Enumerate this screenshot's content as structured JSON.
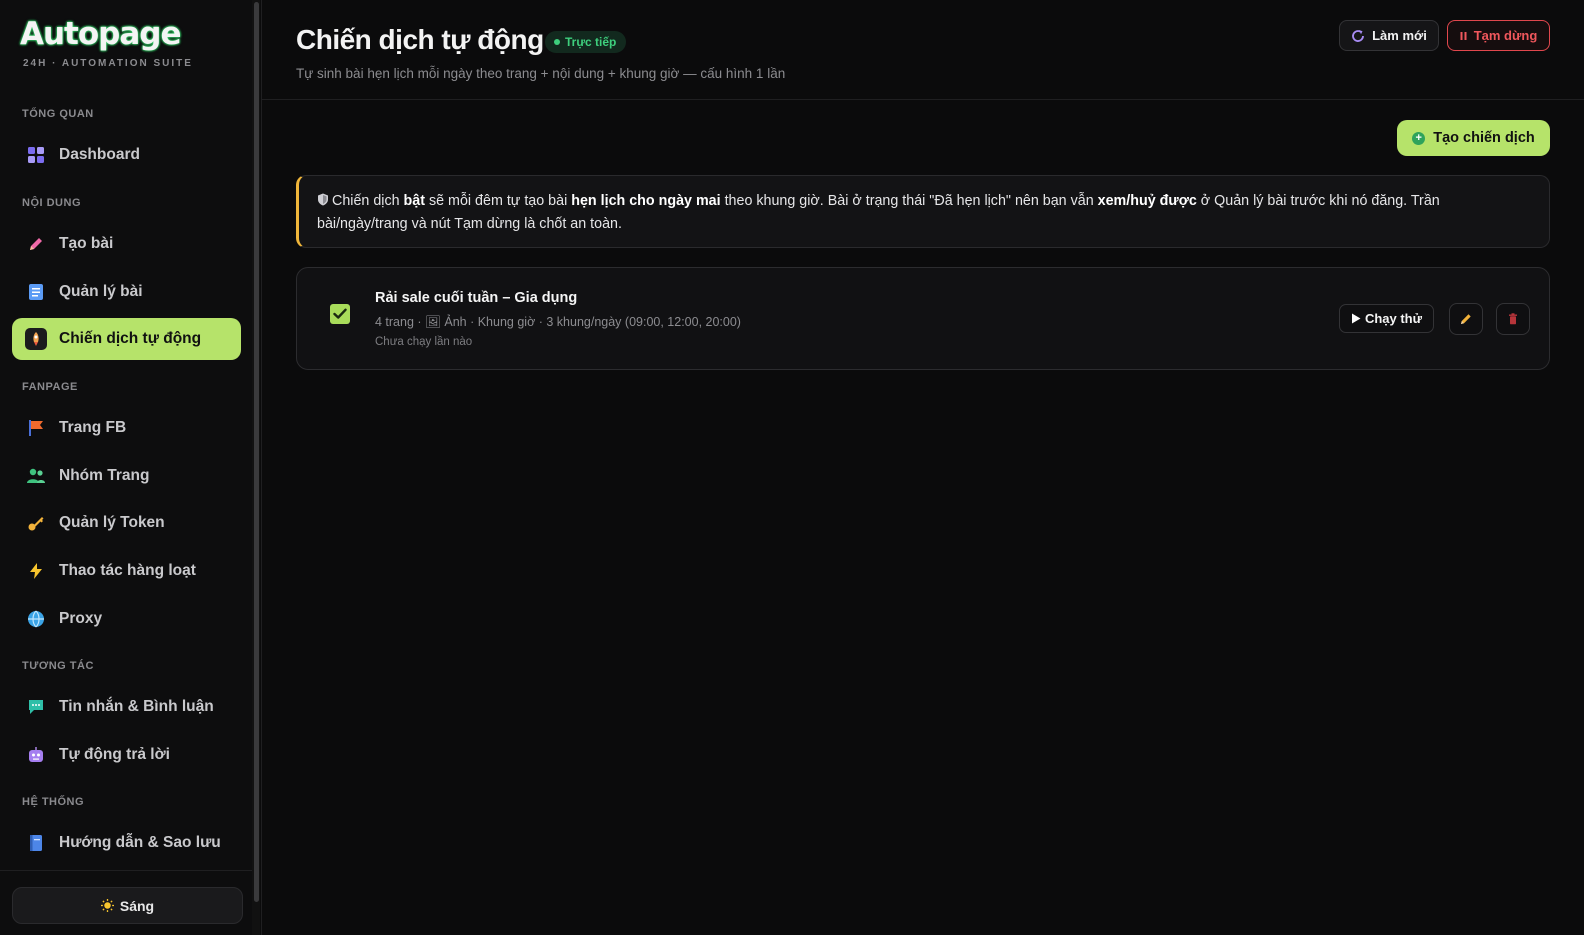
{
  "brand": {
    "name": "Autopage",
    "tagline": "24H · AUTOMATION SUITE",
    "accent": "#b6e36a"
  },
  "sidebar": {
    "sections": [
      {
        "title": "TỔNG QUAN"
      },
      {
        "title": "NỘI DUNG"
      },
      {
        "title": "FANPAGE"
      },
      {
        "title": "TƯƠNG TÁC"
      },
      {
        "title": "HỆ THỐNG"
      }
    ],
    "items": [
      {
        "label": "Dashboard",
        "icon": "grid-icon"
      },
      {
        "label": "Tạo bài",
        "icon": "pencil-icon"
      },
      {
        "label": "Quản lý bài",
        "icon": "document-icon"
      },
      {
        "label": "Chiến dịch tự động",
        "icon": "rocket-icon",
        "active": true
      },
      {
        "label": "Trang FB",
        "icon": "flag-icon"
      },
      {
        "label": "Nhóm Trang",
        "icon": "users-icon"
      },
      {
        "label": "Quản lý Token",
        "icon": "key-icon"
      },
      {
        "label": "Thao tác hàng loạt",
        "icon": "lightning-icon"
      },
      {
        "label": "Proxy",
        "icon": "globe-icon"
      },
      {
        "label": "Tin nhắn & Bình luận",
        "icon": "chat-icon"
      },
      {
        "label": "Tự động trả lời",
        "icon": "robot-icon"
      },
      {
        "label": "Hướng dẫn & Sao lưu",
        "icon": "book-icon"
      }
    ],
    "theme_toggle": "Sáng"
  },
  "header": {
    "title": "Chiến dịch tự động",
    "live_badge": "Trực tiếp",
    "subtitle": "Tự sinh bài hẹn lịch mỗi ngày theo trang + nội dung + khung giờ — cấu hình 1 lần",
    "refresh_label": "Làm mới",
    "pause_label": "Tạm dừng"
  },
  "actions": {
    "create_label": "Tạo chiến dịch"
  },
  "info": {
    "p1": "Chiến dịch ",
    "b1": "bật",
    "p2": " sẽ mỗi đêm tự tạo bài ",
    "b2": "hẹn lịch cho ngày mai",
    "p3": " theo khung giờ. Bài ở trạng thái \"Đã hẹn lịch\" nên bạn vẫn ",
    "b3": "xem/huỷ được",
    "p4": " ở Quản lý bài trước khi nó đăng. Trần bài/ngày/trang và nút Tạm dừng là chốt an toàn."
  },
  "campaigns": [
    {
      "name": "Rải sale cuối tuần – Gia dụng",
      "meta": "4 trang · 🖼 Ảnh · Khung giờ · 3 khung/ngày (09:00, 12:00, 20:00)",
      "status": "Chưa chạy lần nào",
      "enabled": true,
      "run_label": "Chạy thử"
    }
  ],
  "colors": {
    "danger": "#f0575c",
    "live": "#3ecf7d",
    "warning_border": "#f0b63a"
  }
}
